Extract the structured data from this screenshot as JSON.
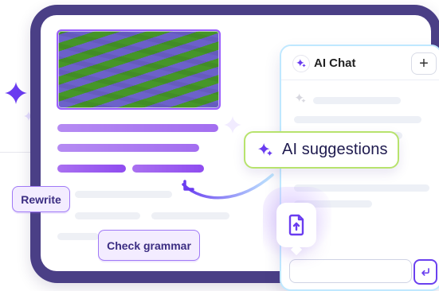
{
  "canvas": {
    "width": 551,
    "height": 365
  },
  "labels": {
    "rewrite": "Rewrite",
    "check_grammar": "Check grammar",
    "ai_suggestions": "AI suggestions"
  },
  "chat": {
    "title": "AI Chat",
    "plus_label": "+"
  },
  "icons": {
    "ai_chat": "sparkles-icon",
    "plus": "plus-icon",
    "ai_suggestions": "sparkles-icon",
    "upload": "upload-file-icon",
    "send": "send-icon",
    "decor_star_large": "sparkle-icon",
    "decor_star_small": "sparkle-icon"
  },
  "colors": {
    "frame": "#4a3f86",
    "accent_purple": "#9a5cff",
    "accent_lime": "#b7e36d",
    "chat_border": "#bfe8ff",
    "text_dark": "#1f1b4f"
  }
}
